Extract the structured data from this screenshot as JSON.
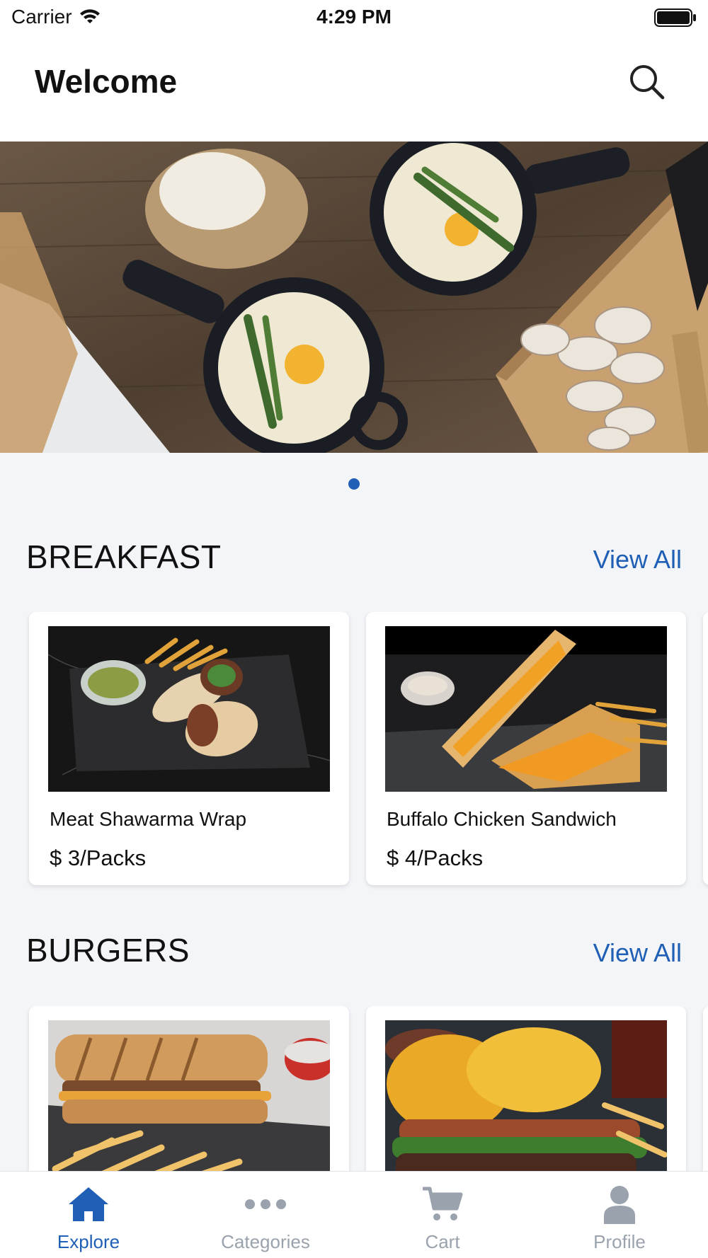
{
  "status_bar": {
    "carrier": "Carrier",
    "time": "4:29 PM"
  },
  "header": {
    "title": "Welcome"
  },
  "sections": [
    {
      "title": "BREAKFAST",
      "view_all": "View All",
      "items": [
        {
          "name": "Meat Shawarma Wrap",
          "price": "$ 3/Packs"
        },
        {
          "name": "Buffalo Chicken Sandwich",
          "price": "$ 4/Packs"
        }
      ]
    },
    {
      "title": "BURGERS",
      "view_all": "View All"
    }
  ],
  "bottom_nav": {
    "items": [
      {
        "label": "Explore",
        "icon": "home-icon",
        "active": true
      },
      {
        "label": "Categories",
        "icon": "more-dots-icon",
        "active": false
      },
      {
        "label": "Cart",
        "icon": "cart-icon",
        "active": false
      },
      {
        "label": "Profile",
        "icon": "person-icon",
        "active": false
      }
    ]
  },
  "colors": {
    "accent": "#1f5fb6",
    "inactive": "#9aa3ad",
    "background": "#f3f5f8"
  }
}
